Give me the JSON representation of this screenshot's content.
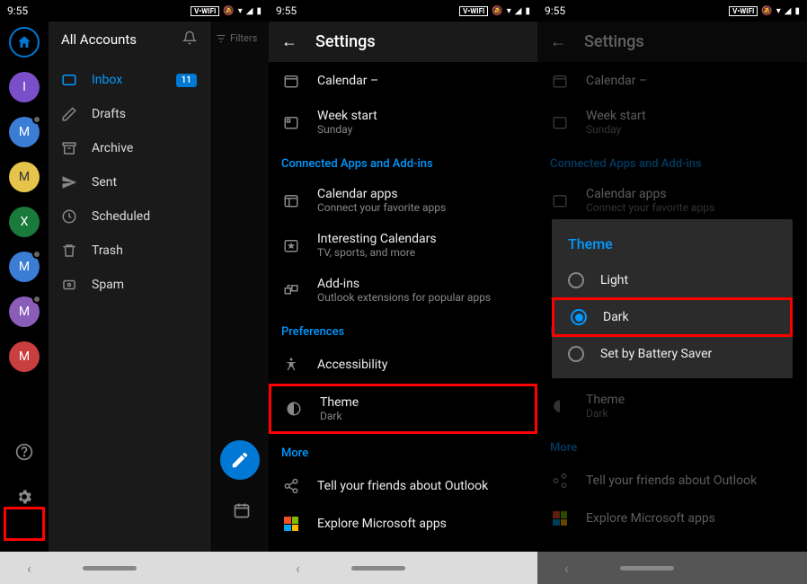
{
  "status": {
    "time": "9:55",
    "wifi": "V•WIFI"
  },
  "screen1": {
    "drawer": {
      "title": "All Accounts",
      "folders": [
        {
          "name": "Inbox",
          "badge": "11",
          "active": true
        },
        {
          "name": "Drafts"
        },
        {
          "name": "Archive"
        },
        {
          "name": "Sent"
        },
        {
          "name": "Scheduled"
        },
        {
          "name": "Trash"
        },
        {
          "name": "Spam"
        }
      ]
    },
    "avatars": [
      "I",
      "M",
      "M",
      "X",
      "M",
      "M",
      "M"
    ],
    "filters": "Filters"
  },
  "settings": {
    "title": "Settings",
    "rows": {
      "calendar_title": "Calendar –",
      "weekstart_title": "Week start",
      "weekstart_sub": "Sunday",
      "connected_header": "Connected Apps and Add-ins",
      "calapps_title": "Calendar apps",
      "calapps_sub": "Connect your favorite apps",
      "interesting_title": "Interesting Calendars",
      "interesting_sub": "TV, sports, and more",
      "addins_title": "Add-ins",
      "addins_sub": "Outlook extensions for popular apps",
      "prefs_header": "Preferences",
      "accessibility_title": "Accessibility",
      "theme_title": "Theme",
      "theme_sub": "Dark",
      "more_header": "More",
      "tell_title": "Tell your friends about Outlook",
      "explore_title": "Explore Microsoft apps"
    }
  },
  "dialog": {
    "title": "Theme",
    "options": [
      "Light",
      "Dark",
      "Set by Battery Saver"
    ],
    "selected": 1
  }
}
